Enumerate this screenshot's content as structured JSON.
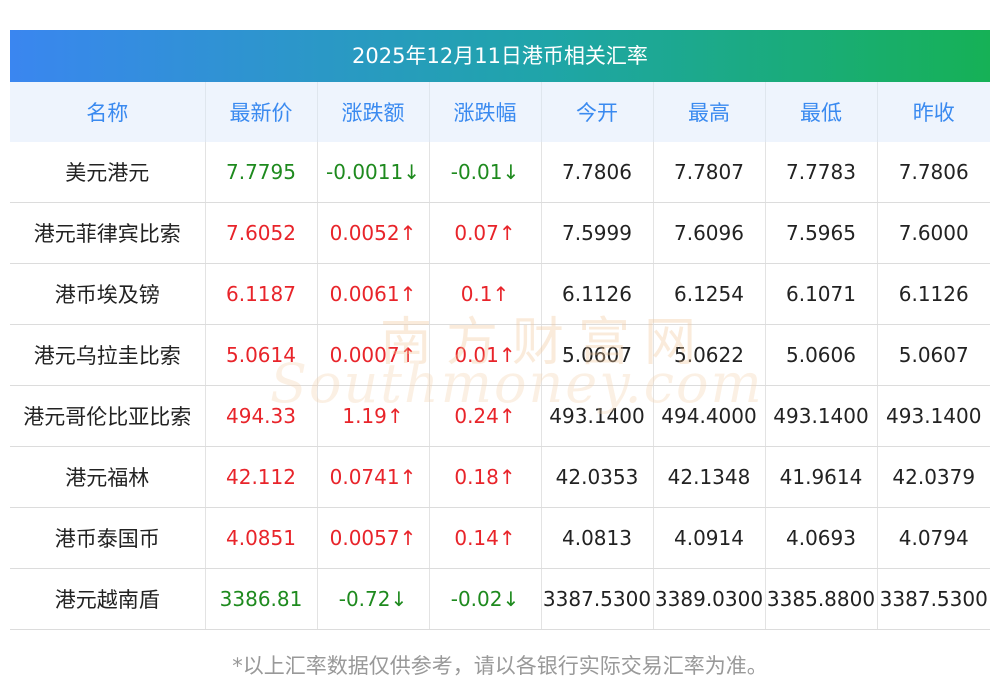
{
  "title": "2025年12月11日港币相关汇率",
  "headers": [
    "名称",
    "最新价",
    "涨跌额",
    "涨跌幅",
    "今开",
    "最高",
    "最低",
    "昨收"
  ],
  "rows": [
    {
      "name": "美元港元",
      "latest": "7.7795",
      "change": "-0.0011↓",
      "pct": "-0.01↓",
      "open": "7.7806",
      "high": "7.7807",
      "low": "7.7783",
      "prev": "7.7806",
      "dir": "down"
    },
    {
      "name": "港元菲律宾比索",
      "latest": "7.6052",
      "change": "0.0052↑",
      "pct": "0.07↑",
      "open": "7.5999",
      "high": "7.6096",
      "low": "7.5965",
      "prev": "7.6000",
      "dir": "up"
    },
    {
      "name": "港币埃及镑",
      "latest": "6.1187",
      "change": "0.0061↑",
      "pct": "0.1↑",
      "open": "6.1126",
      "high": "6.1254",
      "low": "6.1071",
      "prev": "6.1126",
      "dir": "up"
    },
    {
      "name": "港元乌拉圭比索",
      "latest": "5.0614",
      "change": "0.0007↑",
      "pct": "0.01↑",
      "open": "5.0607",
      "high": "5.0622",
      "low": "5.0606",
      "prev": "5.0607",
      "dir": "up"
    },
    {
      "name": "港元哥伦比亚比索",
      "latest": "494.33",
      "change": "1.19↑",
      "pct": "0.24↑",
      "open": "493.1400",
      "high": "494.4000",
      "low": "493.1400",
      "prev": "493.1400",
      "dir": "up"
    },
    {
      "name": "港元福林",
      "latest": "42.112",
      "change": "0.0741↑",
      "pct": "0.18↑",
      "open": "42.0353",
      "high": "42.1348",
      "low": "41.9614",
      "prev": "42.0379",
      "dir": "up"
    },
    {
      "name": "港币泰国币",
      "latest": "4.0851",
      "change": "0.0057↑",
      "pct": "0.14↑",
      "open": "4.0813",
      "high": "4.0914",
      "low": "4.0693",
      "prev": "4.0794",
      "dir": "up"
    },
    {
      "name": "港元越南盾",
      "latest": "3386.81",
      "change": "-0.72↓",
      "pct": "-0.02↓",
      "open": "3387.5300",
      "high": "3389.0300",
      "low": "3385.8800",
      "prev": "3387.5300",
      "dir": "down"
    }
  ],
  "footnote": "*以上汇率数据仅供参考，请以各银行实际交易汇率为准。",
  "watermark": {
    "cn": "南方财富网",
    "en": "Southmoney.com"
  },
  "colors": {
    "up": "#e8242a",
    "down": "#1e8a1e",
    "header_text": "#3a8af0",
    "title_start": "#3a86f0",
    "title_end": "#16b156"
  }
}
